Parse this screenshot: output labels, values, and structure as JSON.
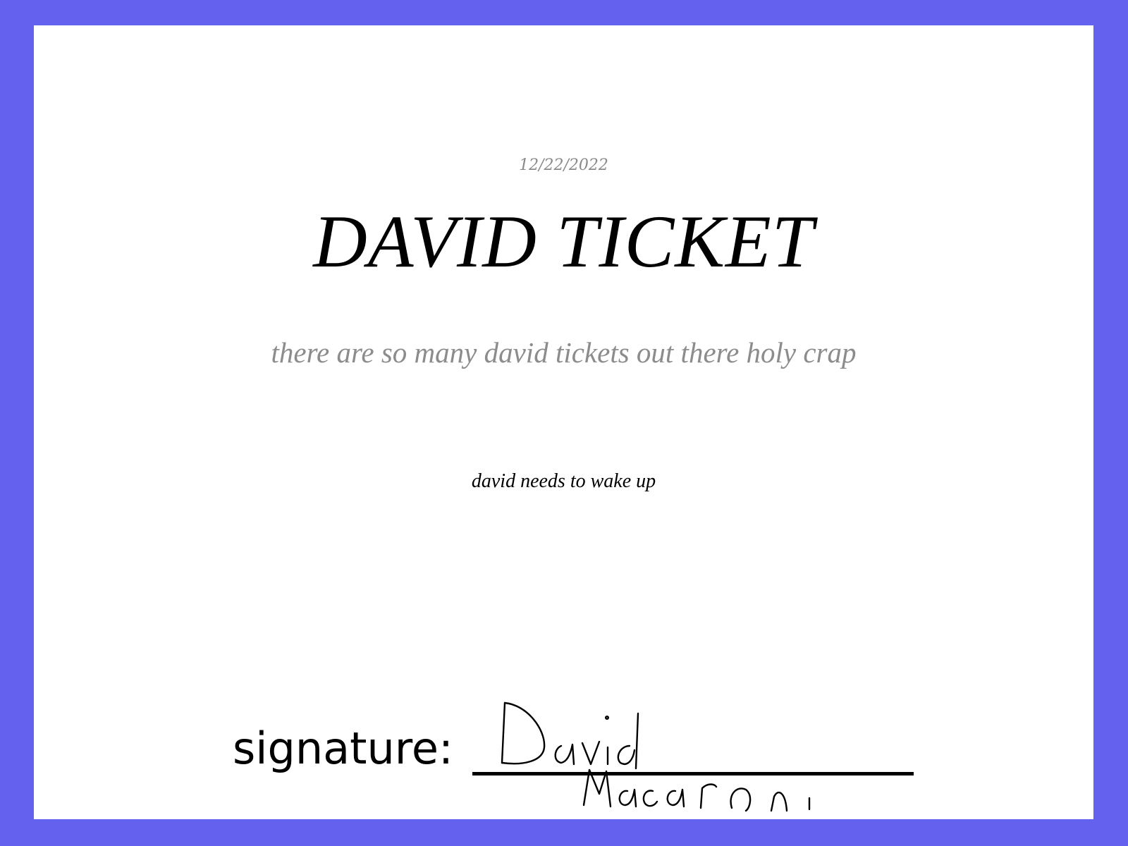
{
  "page": {
    "background_color": "#6461ef",
    "card_color": "#ffffff"
  },
  "ticket": {
    "date": "12/22/2022",
    "title": "DAVID TICKET",
    "subtitle": "there are so many david tickets out there holy crap",
    "message": "david needs to wake up",
    "signature_label": "signature:",
    "signature_text": "David Macaroni"
  }
}
